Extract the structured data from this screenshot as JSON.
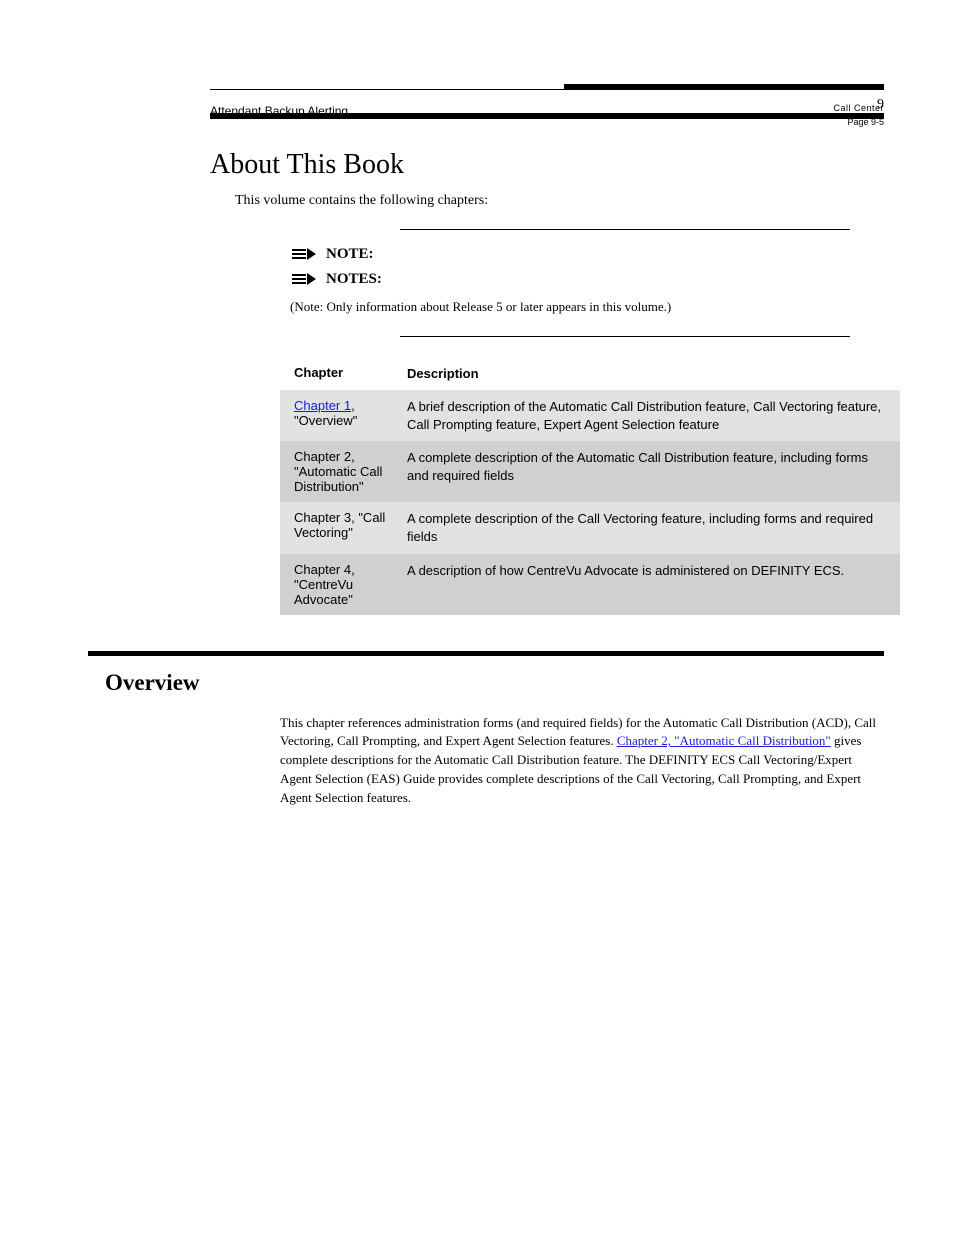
{
  "header": {
    "doc_title": "Attendant Backup Alerting",
    "vol_line": "Call Center",
    "page_label": "Page 9-5",
    "chapter_num": "9"
  },
  "section1": {
    "title": "About This Book",
    "intro": "This volume contains the following chapters:",
    "note1": "NOTE:",
    "note2": "NOTES:",
    "note_explain": "(Note: Only information about Release 5 or later appears in this volume.)",
    "table_header_chapter": "Chapter",
    "table_header_desc": "Description",
    "rows": [
      {
        "num_link": "Chapter 1",
        "num_rest": ", \"Overview\"",
        "desc": "A brief description of the Automatic Call Distribution feature, Call Vectoring feature, Call Prompting feature, Expert Agent Selection feature"
      },
      {
        "num_link": "",
        "num_rest": "Chapter 2, \"Automatic Call Distribution\"",
        "desc": "A complete description of the Automatic Call Distribution feature, including forms and required fields"
      },
      {
        "num_link": "",
        "num_rest": "Chapter 3, \"Call Vectoring\"",
        "desc": "A complete description of the Call Vectoring feature, including forms and required fields"
      },
      {
        "num_link": "",
        "num_rest": "Chapter 4, \"CentreVu Advocate\"",
        "desc": "A description of how CentreVu Advocate is administered on DEFINITY ECS."
      }
    ]
  },
  "section2": {
    "title": "Overview",
    "para": "This chapter references administration forms (and required fields) for the Automatic Call Distribution (ACD), Call Vectoring, Call Prompting, and Expert Agent Selection features. ",
    "link_text": "Chapter 2, \"Automatic Call Distribution\"",
    "para_rest": " gives complete descriptions for the Automatic Call Distribution feature. The DEFINITY ECS Call Vectoring/Expert Agent Selection (EAS) Guide provides complete descriptions of the Call Vectoring, Call Prompting, and Expert Agent Selection features."
  }
}
